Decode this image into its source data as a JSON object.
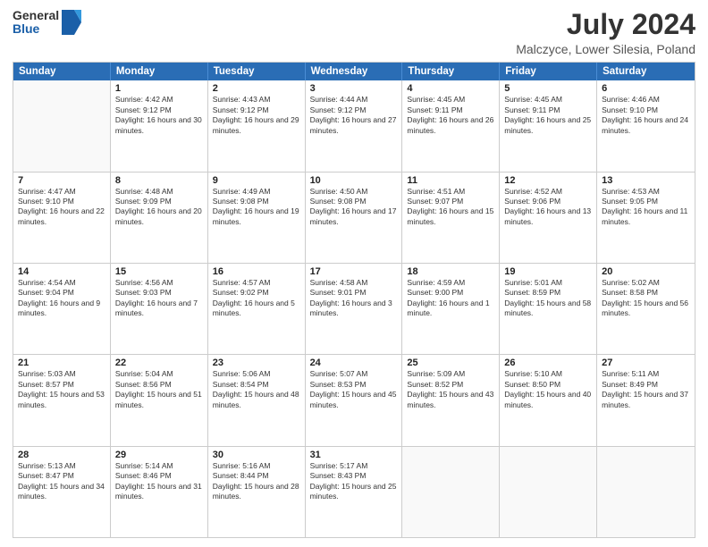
{
  "logo": {
    "general": "General",
    "blue": "Blue"
  },
  "title": {
    "month": "July 2024",
    "location": "Malczyce, Lower Silesia, Poland"
  },
  "weekdays": [
    "Sunday",
    "Monday",
    "Tuesday",
    "Wednesday",
    "Thursday",
    "Friday",
    "Saturday"
  ],
  "weeks": [
    [
      {
        "day": "",
        "sunrise": "",
        "sunset": "",
        "daylight": ""
      },
      {
        "day": "1",
        "sunrise": "Sunrise: 4:42 AM",
        "sunset": "Sunset: 9:12 PM",
        "daylight": "Daylight: 16 hours and 30 minutes."
      },
      {
        "day": "2",
        "sunrise": "Sunrise: 4:43 AM",
        "sunset": "Sunset: 9:12 PM",
        "daylight": "Daylight: 16 hours and 29 minutes."
      },
      {
        "day": "3",
        "sunrise": "Sunrise: 4:44 AM",
        "sunset": "Sunset: 9:12 PM",
        "daylight": "Daylight: 16 hours and 27 minutes."
      },
      {
        "day": "4",
        "sunrise": "Sunrise: 4:45 AM",
        "sunset": "Sunset: 9:11 PM",
        "daylight": "Daylight: 16 hours and 26 minutes."
      },
      {
        "day": "5",
        "sunrise": "Sunrise: 4:45 AM",
        "sunset": "Sunset: 9:11 PM",
        "daylight": "Daylight: 16 hours and 25 minutes."
      },
      {
        "day": "6",
        "sunrise": "Sunrise: 4:46 AM",
        "sunset": "Sunset: 9:10 PM",
        "daylight": "Daylight: 16 hours and 24 minutes."
      }
    ],
    [
      {
        "day": "7",
        "sunrise": "Sunrise: 4:47 AM",
        "sunset": "Sunset: 9:10 PM",
        "daylight": "Daylight: 16 hours and 22 minutes."
      },
      {
        "day": "8",
        "sunrise": "Sunrise: 4:48 AM",
        "sunset": "Sunset: 9:09 PM",
        "daylight": "Daylight: 16 hours and 20 minutes."
      },
      {
        "day": "9",
        "sunrise": "Sunrise: 4:49 AM",
        "sunset": "Sunset: 9:08 PM",
        "daylight": "Daylight: 16 hours and 19 minutes."
      },
      {
        "day": "10",
        "sunrise": "Sunrise: 4:50 AM",
        "sunset": "Sunset: 9:08 PM",
        "daylight": "Daylight: 16 hours and 17 minutes."
      },
      {
        "day": "11",
        "sunrise": "Sunrise: 4:51 AM",
        "sunset": "Sunset: 9:07 PM",
        "daylight": "Daylight: 16 hours and 15 minutes."
      },
      {
        "day": "12",
        "sunrise": "Sunrise: 4:52 AM",
        "sunset": "Sunset: 9:06 PM",
        "daylight": "Daylight: 16 hours and 13 minutes."
      },
      {
        "day": "13",
        "sunrise": "Sunrise: 4:53 AM",
        "sunset": "Sunset: 9:05 PM",
        "daylight": "Daylight: 16 hours and 11 minutes."
      }
    ],
    [
      {
        "day": "14",
        "sunrise": "Sunrise: 4:54 AM",
        "sunset": "Sunset: 9:04 PM",
        "daylight": "Daylight: 16 hours and 9 minutes."
      },
      {
        "day": "15",
        "sunrise": "Sunrise: 4:56 AM",
        "sunset": "Sunset: 9:03 PM",
        "daylight": "Daylight: 16 hours and 7 minutes."
      },
      {
        "day": "16",
        "sunrise": "Sunrise: 4:57 AM",
        "sunset": "Sunset: 9:02 PM",
        "daylight": "Daylight: 16 hours and 5 minutes."
      },
      {
        "day": "17",
        "sunrise": "Sunrise: 4:58 AM",
        "sunset": "Sunset: 9:01 PM",
        "daylight": "Daylight: 16 hours and 3 minutes."
      },
      {
        "day": "18",
        "sunrise": "Sunrise: 4:59 AM",
        "sunset": "Sunset: 9:00 PM",
        "daylight": "Daylight: 16 hours and 1 minute."
      },
      {
        "day": "19",
        "sunrise": "Sunrise: 5:01 AM",
        "sunset": "Sunset: 8:59 PM",
        "daylight": "Daylight: 15 hours and 58 minutes."
      },
      {
        "day": "20",
        "sunrise": "Sunrise: 5:02 AM",
        "sunset": "Sunset: 8:58 PM",
        "daylight": "Daylight: 15 hours and 56 minutes."
      }
    ],
    [
      {
        "day": "21",
        "sunrise": "Sunrise: 5:03 AM",
        "sunset": "Sunset: 8:57 PM",
        "daylight": "Daylight: 15 hours and 53 minutes."
      },
      {
        "day": "22",
        "sunrise": "Sunrise: 5:04 AM",
        "sunset": "Sunset: 8:56 PM",
        "daylight": "Daylight: 15 hours and 51 minutes."
      },
      {
        "day": "23",
        "sunrise": "Sunrise: 5:06 AM",
        "sunset": "Sunset: 8:54 PM",
        "daylight": "Daylight: 15 hours and 48 minutes."
      },
      {
        "day": "24",
        "sunrise": "Sunrise: 5:07 AM",
        "sunset": "Sunset: 8:53 PM",
        "daylight": "Daylight: 15 hours and 45 minutes."
      },
      {
        "day": "25",
        "sunrise": "Sunrise: 5:09 AM",
        "sunset": "Sunset: 8:52 PM",
        "daylight": "Daylight: 15 hours and 43 minutes."
      },
      {
        "day": "26",
        "sunrise": "Sunrise: 5:10 AM",
        "sunset": "Sunset: 8:50 PM",
        "daylight": "Daylight: 15 hours and 40 minutes."
      },
      {
        "day": "27",
        "sunrise": "Sunrise: 5:11 AM",
        "sunset": "Sunset: 8:49 PM",
        "daylight": "Daylight: 15 hours and 37 minutes."
      }
    ],
    [
      {
        "day": "28",
        "sunrise": "Sunrise: 5:13 AM",
        "sunset": "Sunset: 8:47 PM",
        "daylight": "Daylight: 15 hours and 34 minutes."
      },
      {
        "day": "29",
        "sunrise": "Sunrise: 5:14 AM",
        "sunset": "Sunset: 8:46 PM",
        "daylight": "Daylight: 15 hours and 31 minutes."
      },
      {
        "day": "30",
        "sunrise": "Sunrise: 5:16 AM",
        "sunset": "Sunset: 8:44 PM",
        "daylight": "Daylight: 15 hours and 28 minutes."
      },
      {
        "day": "31",
        "sunrise": "Sunrise: 5:17 AM",
        "sunset": "Sunset: 8:43 PM",
        "daylight": "Daylight: 15 hours and 25 minutes."
      },
      {
        "day": "",
        "sunrise": "",
        "sunset": "",
        "daylight": ""
      },
      {
        "day": "",
        "sunrise": "",
        "sunset": "",
        "daylight": ""
      },
      {
        "day": "",
        "sunrise": "",
        "sunset": "",
        "daylight": ""
      }
    ]
  ]
}
